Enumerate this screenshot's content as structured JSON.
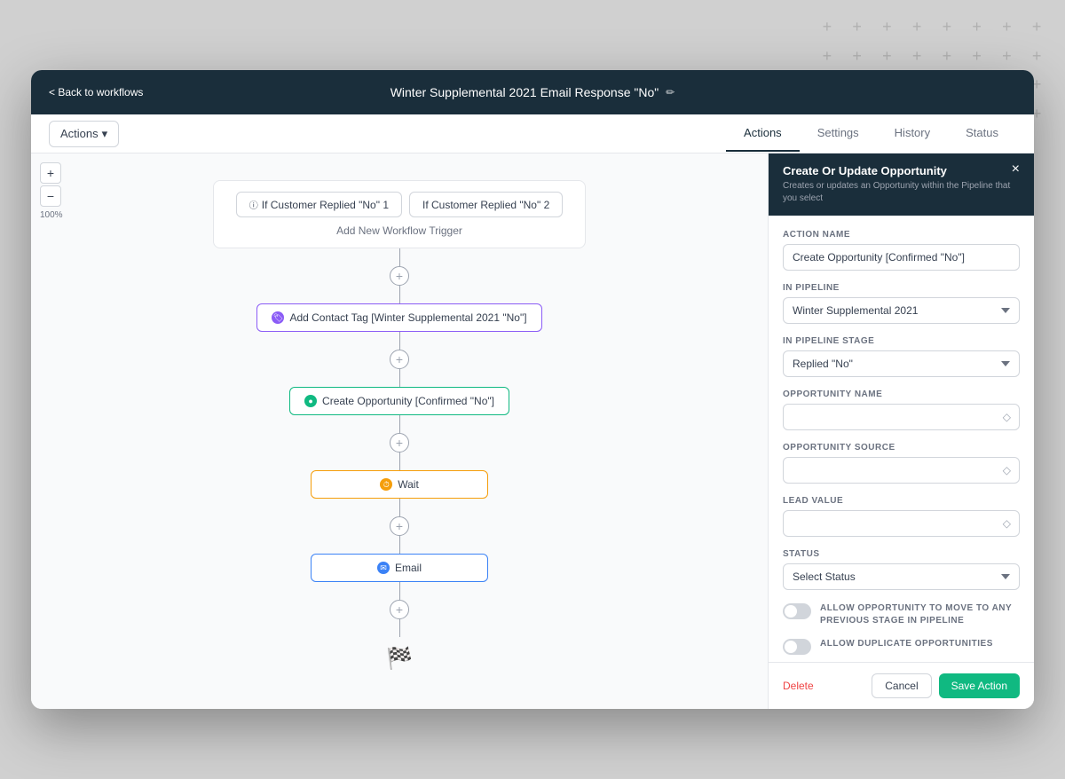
{
  "header": {
    "back_label": "< Back to workflows",
    "title": "Winter Supplemental 2021 Email Response \"No\"",
    "edit_icon": "✏"
  },
  "tabs": {
    "actions_dropdown": "Actions",
    "items": [
      {
        "label": "Actions",
        "active": true
      },
      {
        "label": "Settings",
        "active": false
      },
      {
        "label": "History",
        "active": false
      },
      {
        "label": "Status",
        "active": false
      }
    ]
  },
  "canvas": {
    "zoom_in": "+",
    "zoom_out": "−",
    "zoom_level": "100%",
    "triggers": {
      "button1": "If Customer Replied \"No\" 1",
      "button2": "If Customer Replied \"No\" 2",
      "add_trigger": "Add New Workflow Trigger"
    },
    "nodes": [
      {
        "type": "tag",
        "label": "Add Contact Tag [Winter Supplemental 2021 \"No\"]",
        "icon_type": "purple",
        "icon_char": "🏷"
      },
      {
        "type": "opportunity",
        "label": "Create Opportunity [Confirmed \"No\"]",
        "icon_type": "green",
        "icon_char": "●"
      },
      {
        "type": "wait",
        "label": "Wait",
        "icon_type": "orange",
        "icon_char": "⏱"
      },
      {
        "type": "email",
        "label": "Email",
        "icon_type": "blue",
        "icon_char": "✉"
      }
    ],
    "finish_flag": "🏁"
  },
  "right_panel": {
    "title": "Create Or Update Opportunity",
    "subtitle": "Creates or updates an Opportunity within the Pipeline that you select",
    "close_icon": "×",
    "fields": {
      "action_name": {
        "label": "ACTION NAME",
        "value": "Create Opportunity [Confirmed \"No\"]"
      },
      "in_pipeline": {
        "label": "IN PIPELINE",
        "value": "Winter Supplemental 2021",
        "options": [
          "Winter Supplemental 2021"
        ]
      },
      "in_pipeline_stage": {
        "label": "IN PIPELINE STAGE",
        "value": "Replied \"No\"",
        "options": [
          "Replied \"No\""
        ]
      },
      "opportunity_name": {
        "label": "OPPORTUNITY NAME",
        "value": "",
        "placeholder": ""
      },
      "opportunity_source": {
        "label": "OPPORTUNITY SOURCE",
        "value": "",
        "placeholder": ""
      },
      "lead_value": {
        "label": "LEAD VALUE",
        "value": "",
        "placeholder": ""
      },
      "status": {
        "label": "STATUS",
        "value": "Select Status",
        "options": [
          "Select Status"
        ]
      }
    },
    "toggles": [
      {
        "label": "ALLOW OPPORTUNITY TO MOVE TO ANY PREVIOUS STAGE IN PIPELINE",
        "checked": false
      },
      {
        "label": "ALLOW DUPLICATE OPPORTUNITIES",
        "checked": false
      }
    ],
    "footer": {
      "delete_label": "Delete",
      "cancel_label": "Cancel",
      "save_label": "Save Action"
    }
  }
}
